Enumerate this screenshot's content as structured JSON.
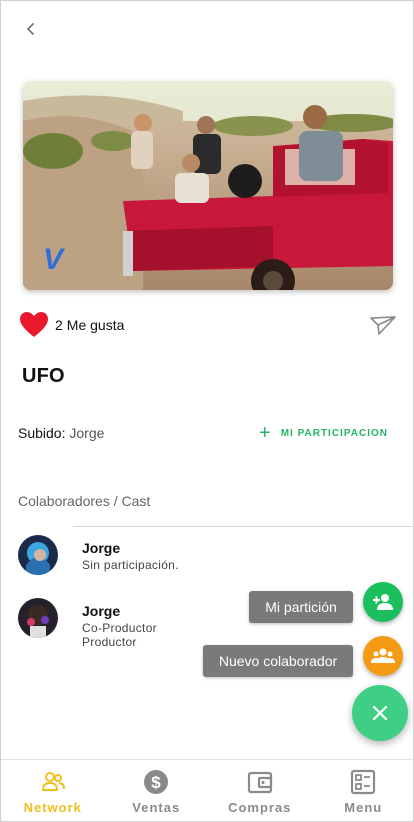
{
  "header": {
    "back_icon": "chevron-left-icon"
  },
  "media": {
    "logo_icon": "vimeo-logo"
  },
  "likes": {
    "count": "2",
    "label": "Me gusta",
    "heart_color": "#e8192c"
  },
  "title": "UFO",
  "upload": {
    "label": "Subido:",
    "user": "Jorge"
  },
  "participation": {
    "plus": "+",
    "label": "MI PARTICIPACION"
  },
  "collaborators": {
    "title": "Colaboradores / Cast",
    "items": [
      {
        "name": "Jorge",
        "roles": [
          "Sin participación."
        ]
      },
      {
        "name": "Jorge",
        "roles": [
          "Co-Productor",
          "Productor"
        ]
      }
    ]
  },
  "fab": {
    "mi_particion": "Mi partición",
    "nuevo_colaborador": "Nuevo colaborador",
    "green": "#1bbf5e",
    "orange": "#f59a14",
    "main": "#3ecf85"
  },
  "nav": {
    "items": [
      {
        "label": "Network",
        "icon": "people-icon",
        "active": true
      },
      {
        "label": "Ventas",
        "icon": "dollar-icon",
        "active": false
      },
      {
        "label": "Compras",
        "icon": "wallet-icon",
        "active": false
      },
      {
        "label": "Menu",
        "icon": "menu-grid-icon",
        "active": false
      }
    ],
    "active_color": "#f0c020"
  }
}
